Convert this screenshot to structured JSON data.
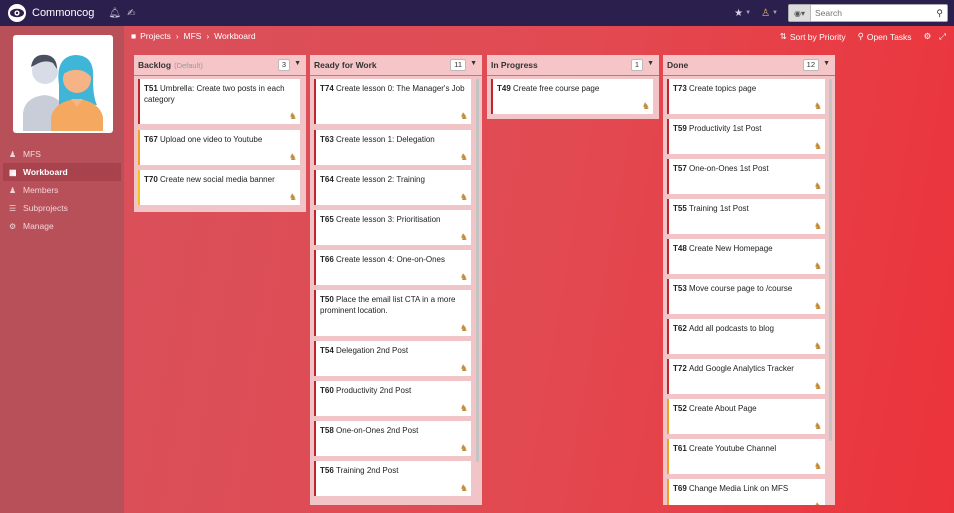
{
  "app": {
    "brand": "Commoncog"
  },
  "search": {
    "placeholder": "Search"
  },
  "breadcrumb": [
    "Projects",
    "MFS",
    "Workboard"
  ],
  "toolbar": {
    "sort_label": "Sort by Priority",
    "open_tasks_label": "Open Tasks"
  },
  "sidebar": {
    "items": [
      {
        "label": "MFS",
        "icon": "users-icon"
      },
      {
        "label": "Workboard",
        "icon": "board-icon",
        "active": true
      },
      {
        "label": "Members",
        "icon": "members-icon"
      },
      {
        "label": "Subprojects",
        "icon": "subprojects-icon"
      },
      {
        "label": "Manage",
        "icon": "gears-icon"
      }
    ]
  },
  "colors": {
    "topbar": "#2b1f4d",
    "sidebar": "#b8505a",
    "priority_high": "#c0242c",
    "priority_normal": "#f0a020",
    "priority_low": "#f2c419"
  },
  "columns": [
    {
      "title": "Backlog",
      "subtitle": "(Default)",
      "count": "3",
      "cards": [
        {
          "id": "T51",
          "title": "Umbrella: Create two posts in each category",
          "priority": "high"
        },
        {
          "id": "T67",
          "title": "Upload one video to Youtube",
          "priority": "normal"
        },
        {
          "id": "T70",
          "title": "Create new social media banner",
          "priority": "low"
        }
      ]
    },
    {
      "title": "Ready for Work",
      "subtitle": "",
      "count": "11",
      "cards": [
        {
          "id": "T74",
          "title": "Create lesson 0: The Manager's Job",
          "priority": "high"
        },
        {
          "id": "T63",
          "title": "Create lesson 1: Delegation",
          "priority": "high"
        },
        {
          "id": "T64",
          "title": "Create lesson 2: Training",
          "priority": "high"
        },
        {
          "id": "T65",
          "title": "Create lesson 3: Prioritisation",
          "priority": "high"
        },
        {
          "id": "T66",
          "title": "Create lesson 4: One-on-Ones",
          "priority": "high"
        },
        {
          "id": "T50",
          "title": "Place the email list CTA in a more prominent location.",
          "priority": "high"
        },
        {
          "id": "T54",
          "title": "Delegation 2nd Post",
          "priority": "high"
        },
        {
          "id": "T60",
          "title": "Productivity 2nd Post",
          "priority": "high"
        },
        {
          "id": "T58",
          "title": "One-on-Ones 2nd Post",
          "priority": "high"
        },
        {
          "id": "T56",
          "title": "Training 2nd Post",
          "priority": "high"
        }
      ]
    },
    {
      "title": "In Progress",
      "subtitle": "",
      "count": "1",
      "cards": [
        {
          "id": "T49",
          "title": "Create free course page",
          "priority": "high"
        }
      ]
    },
    {
      "title": "Done",
      "subtitle": "",
      "count": "12",
      "cards": [
        {
          "id": "T73",
          "title": "Create topics page",
          "priority": "high"
        },
        {
          "id": "T59",
          "title": "Productivity 1st Post",
          "priority": "high"
        },
        {
          "id": "T57",
          "title": "One-on-Ones 1st Post",
          "priority": "high"
        },
        {
          "id": "T55",
          "title": "Training 1st Post",
          "priority": "high"
        },
        {
          "id": "T48",
          "title": "Create New Homepage",
          "priority": "high"
        },
        {
          "id": "T53",
          "title": "Move course page to /course",
          "priority": "high"
        },
        {
          "id": "T62",
          "title": "Add all podcasts to blog",
          "priority": "high"
        },
        {
          "id": "T72",
          "title": "Add Google Analytics Tracker",
          "priority": "high"
        },
        {
          "id": "T52",
          "title": "Create About Page",
          "priority": "normal"
        },
        {
          "id": "T61",
          "title": "Create Youtube Channel",
          "priority": "normal"
        },
        {
          "id": "T69",
          "title": "Change Media Link on MFS",
          "priority": "normal"
        }
      ]
    }
  ]
}
